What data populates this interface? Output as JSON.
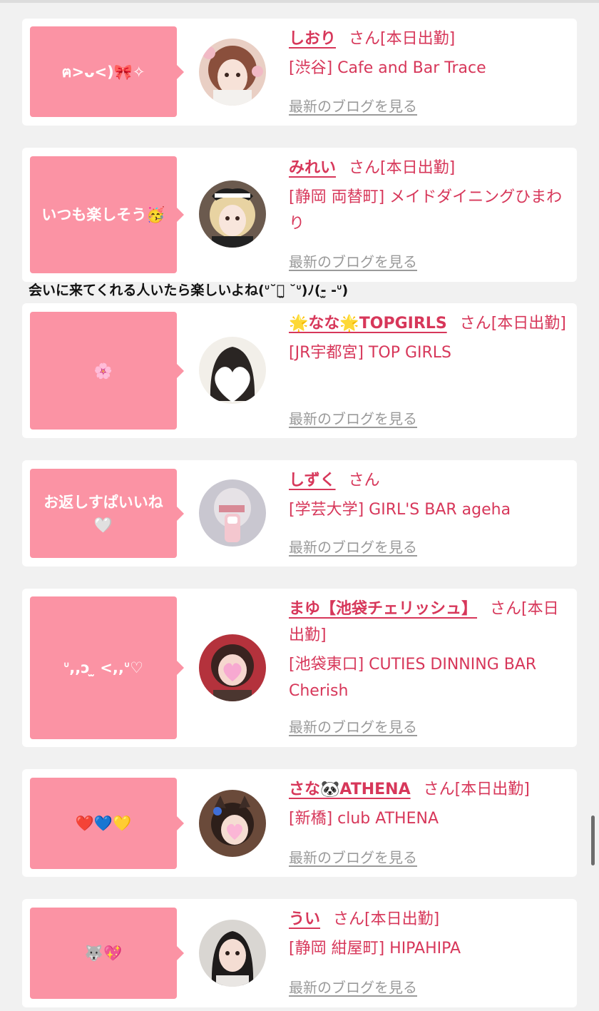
{
  "entries": [
    {
      "comment": "ฅ>ᴗ<)🎀✧",
      "name": "しおり",
      "san": "さん",
      "status": "[本日出勤]",
      "location": "[渋谷] Cafe and Bar Trace",
      "blog_link": "最新のブログを見る",
      "avatar": "photo-brown-hair"
    },
    {
      "comment": "いつも楽しそう🥳",
      "name": "みれい",
      "san": "さん",
      "status": "[本日出勤]",
      "location": "[静岡 両替町] メイドダイニングひまわり",
      "blog_link": "最新のブログを見る",
      "avatar": "photo-blonde-maid"
    },
    {
      "comment": "🌸",
      "name": "🌟なな🌟TOPGIRLS",
      "san": "さん",
      "status": "[本日出勤]",
      "location": "[JR宇都宮] TOP GIRLS",
      "blog_link": "最新のブログを見る",
      "avatar": "photo-heart-cover"
    },
    {
      "comment": "お返しすぱいいね🤍",
      "name": "しずく",
      "san": "さん",
      "status": "",
      "location": "[学芸大学] GIRL'S BAR ageha",
      "blog_link": "最新のブログを見る",
      "avatar": "photo-mirror-selfie"
    },
    {
      "comment": "ᐡ,,ɔ ̫ <,,ᐡ♡",
      "name": "まゆ【池袋チェリッシュ】",
      "san": "さん",
      "status": "[本日出勤]",
      "location": "[池袋東口] CUTIES DINNING BAR Cherish",
      "blog_link": "最新のブログを見る",
      "avatar": "photo-heart-hands"
    },
    {
      "comment": "❤️💙💛",
      "name": "さな🐼ATHENA",
      "san": "さん",
      "status": "[本日出勤]",
      "location": "[新橋] club ATHENA",
      "blog_link": "最新のブログを見る",
      "avatar": "photo-cat-ears"
    },
    {
      "comment": "🐺💖",
      "name": "うい",
      "san": "さん",
      "status": "[本日出勤]",
      "location": "[静岡 紺屋町] HIPAHIPA",
      "blog_link": "最新のブログを見る",
      "avatar": "photo-dark-hair"
    }
  ],
  "overflow_comment": "会いに来てくれる人いたら楽しいよね(ᐡ˘・̫ ˘ᐡ)ﾉ(-̫ -ᐡ)",
  "colors": {
    "bubble": "#fb93a4",
    "name": "#d7375a",
    "blog_link": "#9a9a9a",
    "background": "#f1f1f1"
  }
}
